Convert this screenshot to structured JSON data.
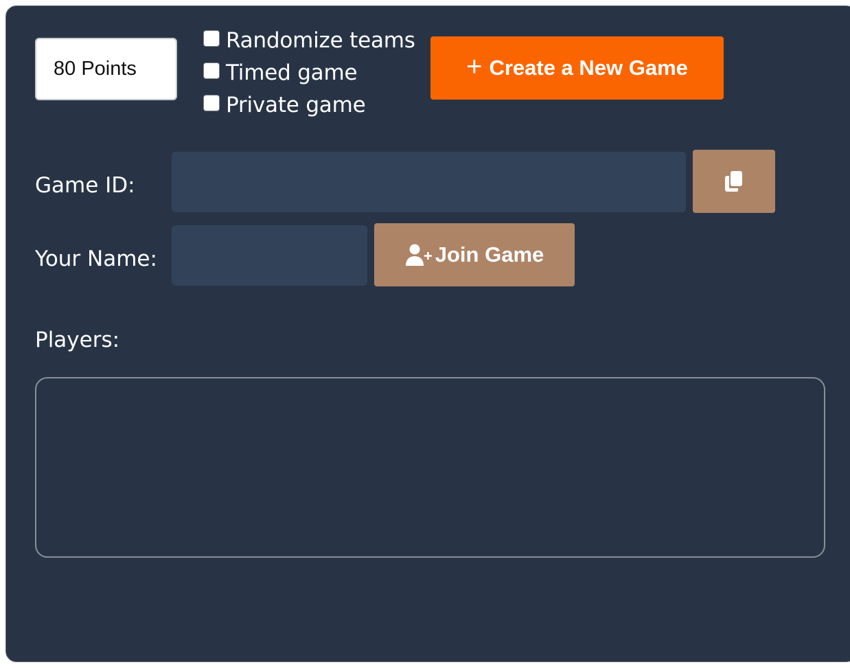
{
  "game_setup": {
    "points_select": {
      "selected": "80 Points"
    },
    "options": [
      {
        "label": "Randomize teams",
        "checked": false
      },
      {
        "label": "Timed game",
        "checked": false
      },
      {
        "label": "Private game",
        "checked": false
      }
    ],
    "create_button": {
      "icon": "plus-icon",
      "label": "Create a New Game"
    }
  },
  "game_id": {
    "label": "Game ID:",
    "value": "",
    "copy_button_icon": "copy-icon"
  },
  "your_name": {
    "label": "Your Name:",
    "value": ""
  },
  "join_button": {
    "icon": "user-plus-icon",
    "label": "Join Game"
  },
  "players": {
    "label": "Players:",
    "items": []
  },
  "colors": {
    "panel_bg": "#283446",
    "input_bg": "#324359",
    "create_button": "#fb6501",
    "secondary_button": "#ae8467"
  }
}
